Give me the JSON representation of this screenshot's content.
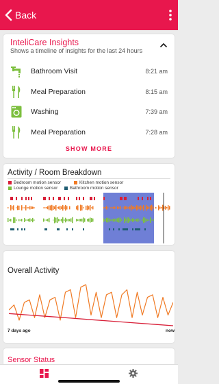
{
  "colors": {
    "accent": "#e8174d",
    "insight_icon": "#7cbf3e",
    "bedroom": "#d81f38",
    "kitchen": "#f07a24",
    "lounge": "#7cbf3e",
    "bathroom": "#1f5d72",
    "highlight": "#6f7fd6",
    "activity_line": "#f07a24",
    "trend_line": "#d81f38"
  },
  "header": {
    "back_label": "Back"
  },
  "insights": {
    "title": "InteliCare Insights",
    "subtitle": "Shows a timeline of insights for the last 24 hours",
    "items": [
      {
        "label": "Bathroom Visit",
        "time": "8:21 am",
        "icon": "faucet-icon"
      },
      {
        "label": "Meal Preparation",
        "time": "8:15 am",
        "icon": "utensils-icon"
      },
      {
        "label": "Washing",
        "time": "7:39 am",
        "icon": "washing-machine-icon"
      },
      {
        "label": "Meal Preparation",
        "time": "7:28 am",
        "icon": "utensils-icon"
      }
    ],
    "show_more": "SHOW MORE"
  },
  "activity_breakdown": {
    "title": "Activity / Room Breakdown",
    "legend": [
      "Bedroom motion sensor",
      "Kitchen motion sensor",
      "Lounge motion sensor",
      "Bathroom motion sensor"
    ]
  },
  "overall_activity": {
    "title": "Overall Activity",
    "start_label": "7 days ago",
    "end_label": "now"
  },
  "sensor_status": {
    "title": "Sensor Status"
  },
  "chart_data": {
    "type": "line",
    "x": [
      "7 days ago",
      "now"
    ],
    "series": [
      {
        "values": [
          0.35,
          0.45,
          0.15,
          0.5,
          0.55,
          0.2,
          0.65,
          0.2,
          0.55,
          0.6,
          0.15,
          0.7,
          0.75,
          0.2,
          0.8,
          0.85,
          0.25,
          0.7,
          0.2,
          0.65,
          0.7,
          0.2,
          0.65,
          0.75,
          0.2,
          0.7,
          0.25,
          0.6,
          0.65,
          0.2,
          0.6,
          0.25,
          0.5
        ]
      },
      {
        "values": [
          0.28,
          0.25,
          0.22,
          0.19,
          0.16,
          0.13,
          0.1,
          0.07,
          0.04
        ]
      }
    ],
    "grid": false
  }
}
